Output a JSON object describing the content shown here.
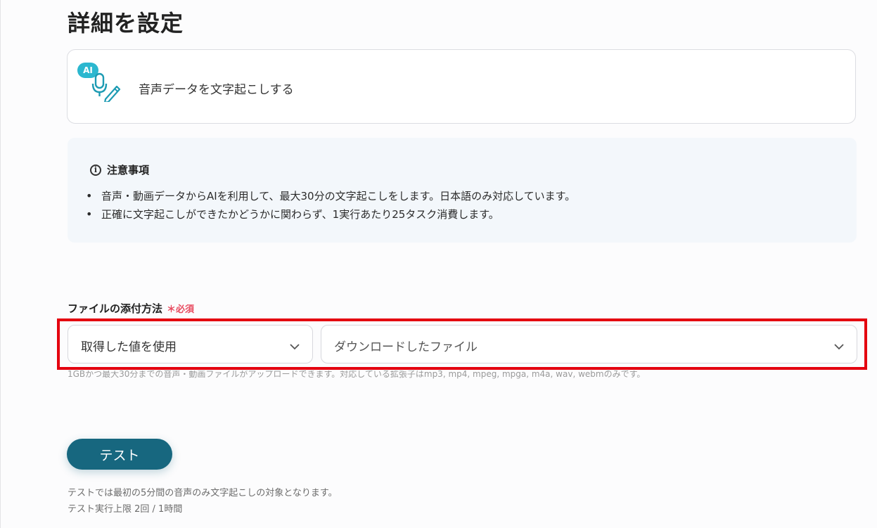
{
  "page": {
    "title": "詳細を設定"
  },
  "action": {
    "badge": "AI",
    "label": "音声データを文字起こしする",
    "icon": "microphone-pen-icon"
  },
  "notice": {
    "icon": "info-icon",
    "title": "注意事項",
    "items": [
      "音声・動画データからAIを利用して、最大30分の文字起こしをします。日本語のみ対応しています。",
      "正確に文字起こしができたかどうかに関わらず、1実行あたり25タスク消費します。"
    ]
  },
  "attachment": {
    "label": "ファイルの添付方法",
    "required": "＊必須",
    "method_value": "取得した値を使用",
    "file_value": "ダウンロードしたファイル",
    "helper": "1GBかつ最大30分までの音声・動画ファイルがアップロードできます。対応している拡張子はmp3, mp4, mpeg, mpga, m4a, wav, webmのみです。"
  },
  "test": {
    "button_label": "テスト",
    "note_line1": "テストでは最初の5分間の音声のみ文字起こしの対象となります。",
    "note_line2": "テスト実行上限 2回 / 1時間"
  },
  "colors": {
    "accent": "#17677f",
    "ai_badge": "#2bb7cf",
    "required": "#e84a5f",
    "highlight": "#e4000f",
    "notice_bg": "#f3f7fb"
  }
}
